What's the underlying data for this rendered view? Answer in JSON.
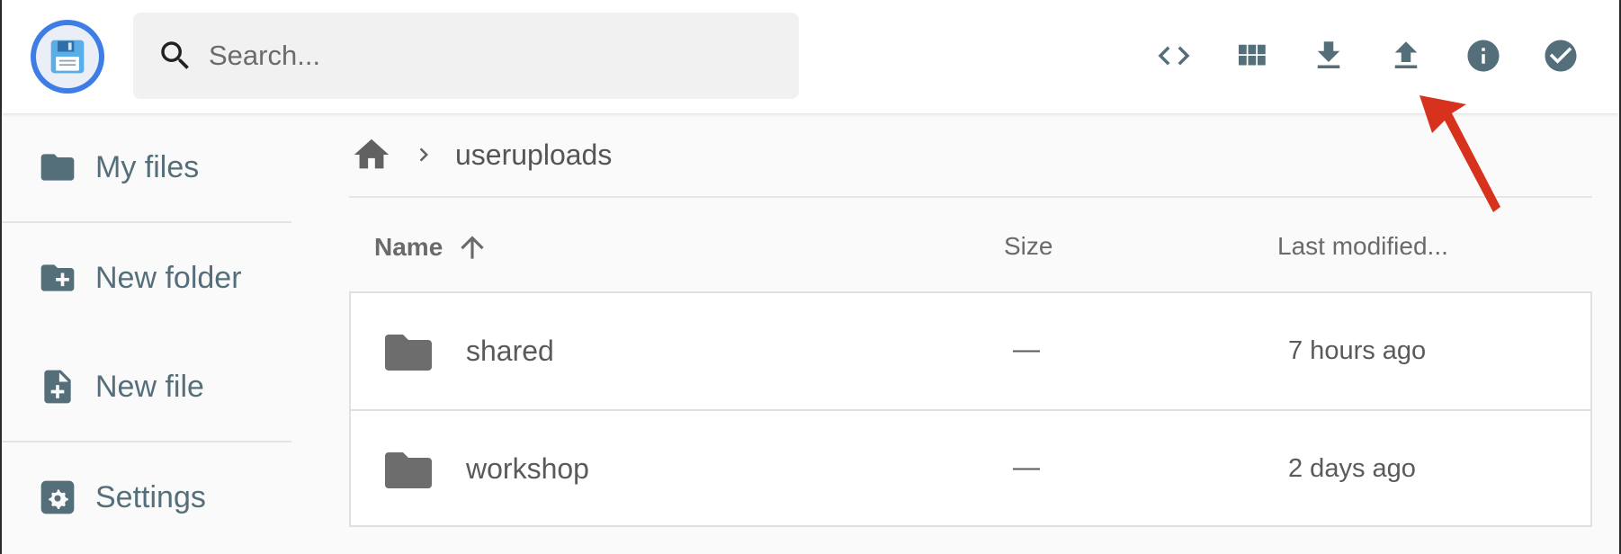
{
  "header": {
    "logo_icon": "floppy-disk-icon",
    "search": {
      "placeholder": "Search...",
      "value": ""
    },
    "actions": [
      {
        "icon": "code-icon"
      },
      {
        "icon": "grid-view-icon"
      },
      {
        "icon": "download-icon"
      },
      {
        "icon": "upload-icon"
      },
      {
        "icon": "info-icon"
      },
      {
        "icon": "select-check-icon"
      }
    ]
  },
  "sidebar": {
    "items": [
      {
        "label": "My files",
        "icon": "folder-icon"
      },
      {
        "label": "New folder",
        "icon": "folder-plus-icon"
      },
      {
        "label": "New file",
        "icon": "file-plus-icon"
      },
      {
        "label": "Settings",
        "icon": "settings-gear-icon"
      }
    ]
  },
  "breadcrumb": {
    "home_icon": "home-icon",
    "current": "useruploads"
  },
  "table": {
    "columns": {
      "name": "Name",
      "size": "Size",
      "modified": "Last modified..."
    },
    "sort": {
      "column": "name",
      "direction": "ascending"
    },
    "rows": [
      {
        "name": "shared",
        "size": "—",
        "modified": "7 hours ago",
        "icon": "folder-icon"
      },
      {
        "name": "workshop",
        "size": "—",
        "modified": "2 days ago",
        "icon": "folder-icon"
      }
    ]
  },
  "colors": {
    "accent": "#3f7de6",
    "icon": "#546e7a",
    "annotation": "#d6321e"
  }
}
